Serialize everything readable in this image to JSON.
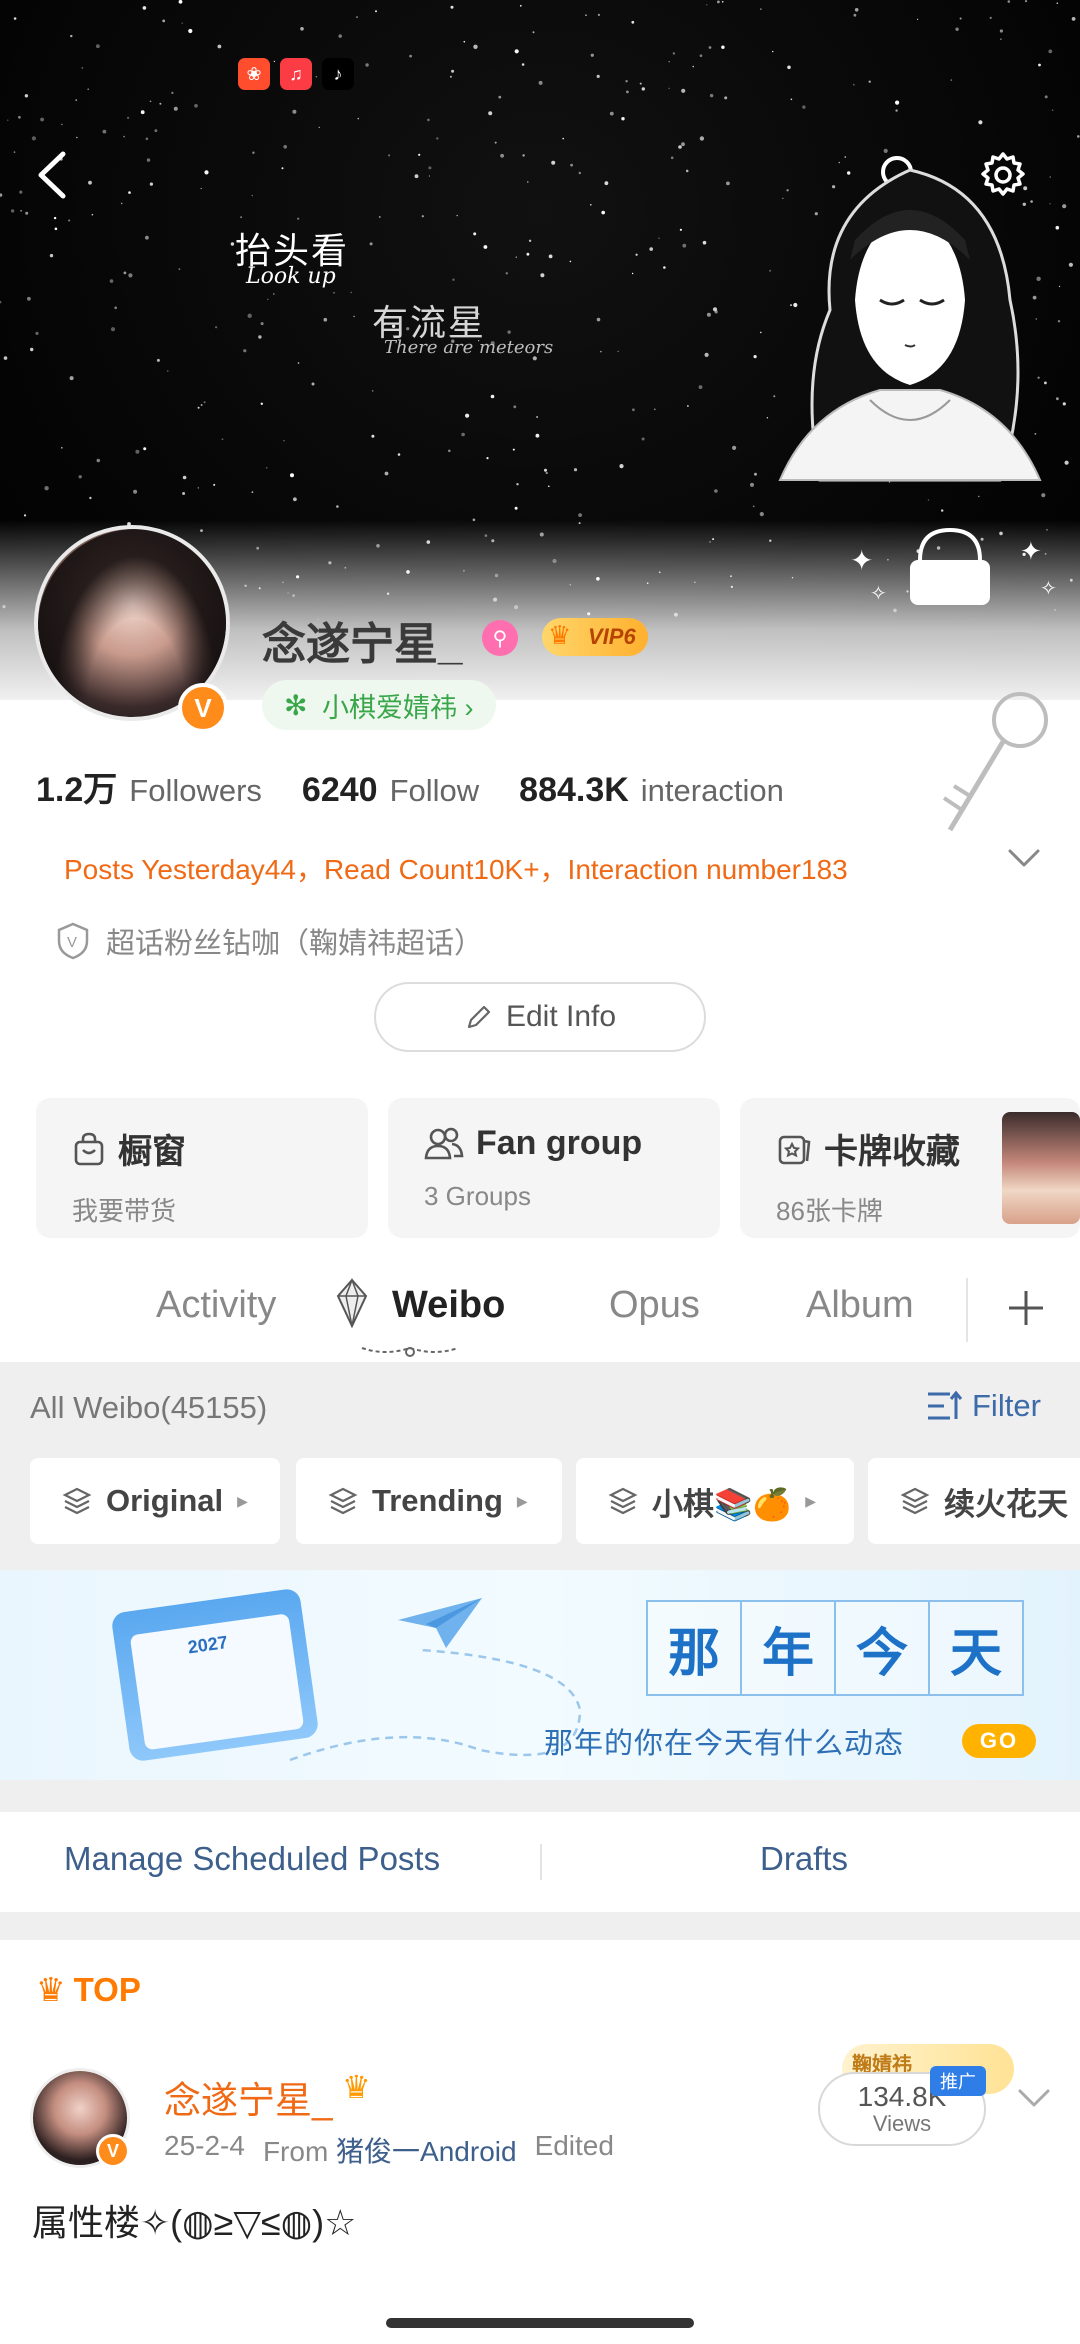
{
  "status_bar": {
    "app_icons": [
      "xiaohongshu-icon",
      "music-icon",
      "tiktok-icon"
    ]
  },
  "banner": {
    "text_cn_1": "抬头看",
    "text_en_1": "Look up",
    "text_cn_2": "有流星",
    "text_en_2": "There are meteors"
  },
  "profile": {
    "username": "念遂宁星_",
    "vip_level": "VIP6",
    "tag": "小棋爱婧祎 ›",
    "stats": [
      {
        "num": "1.2万",
        "label": "Followers"
      },
      {
        "num": "6240",
        "label": "Follow"
      },
      {
        "num": "884.3K",
        "label": "interaction"
      }
    ],
    "activity_summary": "Posts Yesterday44，Read Count10K+，Interaction number183",
    "supertopic": "超话粉丝钻咖（鞠婧祎超话）",
    "edit_button": "Edit Info"
  },
  "cards": [
    {
      "title": "橱窗",
      "sub": "我要带货"
    },
    {
      "title": "Fan group",
      "sub": "3 Groups"
    },
    {
      "title": "卡牌收藏",
      "sub": "86张卡牌"
    }
  ],
  "tabs": [
    {
      "label": "Activity"
    },
    {
      "label": "Weibo",
      "active": true
    },
    {
      "label": "Opus"
    },
    {
      "label": "Album"
    }
  ],
  "feed": {
    "header": "All Weibo(45155)",
    "filter_label": "Filter",
    "chips": [
      "Original",
      "Trending",
      "小棋📚🍊",
      "续火花天"
    ],
    "memory_banner": {
      "year": "2027",
      "title_chars": [
        "那",
        "年",
        "今",
        "天"
      ],
      "subtitle": "那年的你在今天有什么动态",
      "go": "GO"
    },
    "scheduled_label": "Manage Scheduled Posts",
    "drafts_label": "Drafts"
  },
  "post": {
    "top_label": "TOP",
    "author": "念遂宁星_",
    "date": "25-2-4",
    "from": "From",
    "source": "猪俊一Android",
    "edited": "Edited",
    "views": "134.8K",
    "views_label": "Views",
    "promo_topic": "鞠婧祎",
    "promo_badge": "推广",
    "body": "属性楼✧(◍≥▽≤◍)☆"
  },
  "colors": {
    "accent_orange": "#f06a16",
    "link_blue": "#3d5f8c",
    "feed_bg": "#efefef"
  }
}
